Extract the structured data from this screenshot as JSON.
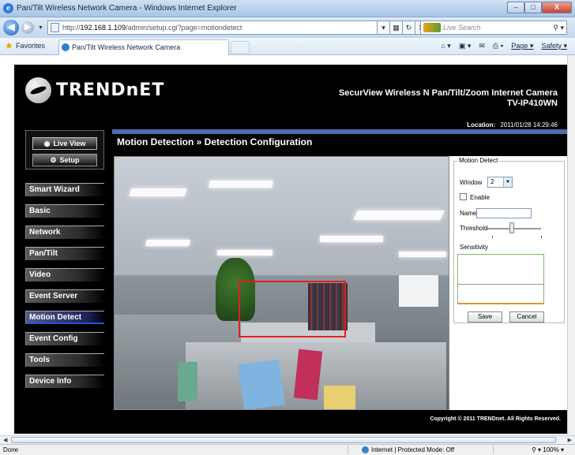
{
  "window": {
    "title": "Pan/Tilt Wireless Network Camera - Windows Internet Explorer",
    "controls": [
      "–",
      "□",
      "X"
    ]
  },
  "address_bar": {
    "url_prefix": "http://",
    "url_host": "192.168.1.109",
    "url_path": "/admin/setup.cgi?page=motiondetect",
    "search_placeholder": "Live Search"
  },
  "favorites_bar": {
    "favorites_label": "Favorites",
    "tab_title": "Pan/Tilt Wireless Network Camera",
    "commands": {
      "page": "Page ▾",
      "safety": "Safety ▾"
    }
  },
  "camera_page": {
    "logo_text": "TRENDnET",
    "product_line1": "SecurView Wireless N Pan/Tilt/Zoom Internet Camera",
    "product_line2": "TV-IP410WN",
    "location_label": "Location:",
    "location_time": "2011/01/28 14:29:46",
    "pane_title": "Motion Detection » Detection Configuration",
    "live_view_label": "Live View",
    "setup_label": "Setup",
    "nav": [
      {
        "label": "Smart Wizard"
      },
      {
        "label": "Basic"
      },
      {
        "label": "Network"
      },
      {
        "label": "Pan/Tilt"
      },
      {
        "label": "Video"
      },
      {
        "label": "Event Server"
      },
      {
        "label": "Motion Detect",
        "active": true
      },
      {
        "label": "Event Config"
      },
      {
        "label": "Tools"
      },
      {
        "label": "Device Info"
      }
    ],
    "motion_panel": {
      "legend": "Motion Detect",
      "window_label": "Window",
      "window_value": "2",
      "enable_label": "Enable",
      "enable_checked": false,
      "name_label": "Name",
      "name_value": "",
      "threshold_label": "Threshold",
      "threshold_level": 0.45,
      "sensitivity_label": "Sensitivity",
      "save_label": "Save",
      "cancel_label": "Cancel"
    },
    "copyright": "Copyright © 2011 TRENDnet. All Rights Reserved."
  },
  "status_bar": {
    "left": "Done",
    "zone": "Internet | Protected Mode: Off",
    "zoom": "100%"
  },
  "colors": {
    "page_bg": "#000000",
    "nav_active": "#2e4bd6",
    "header_accent": "#4a6ea8",
    "detection_box": "#e02020"
  }
}
